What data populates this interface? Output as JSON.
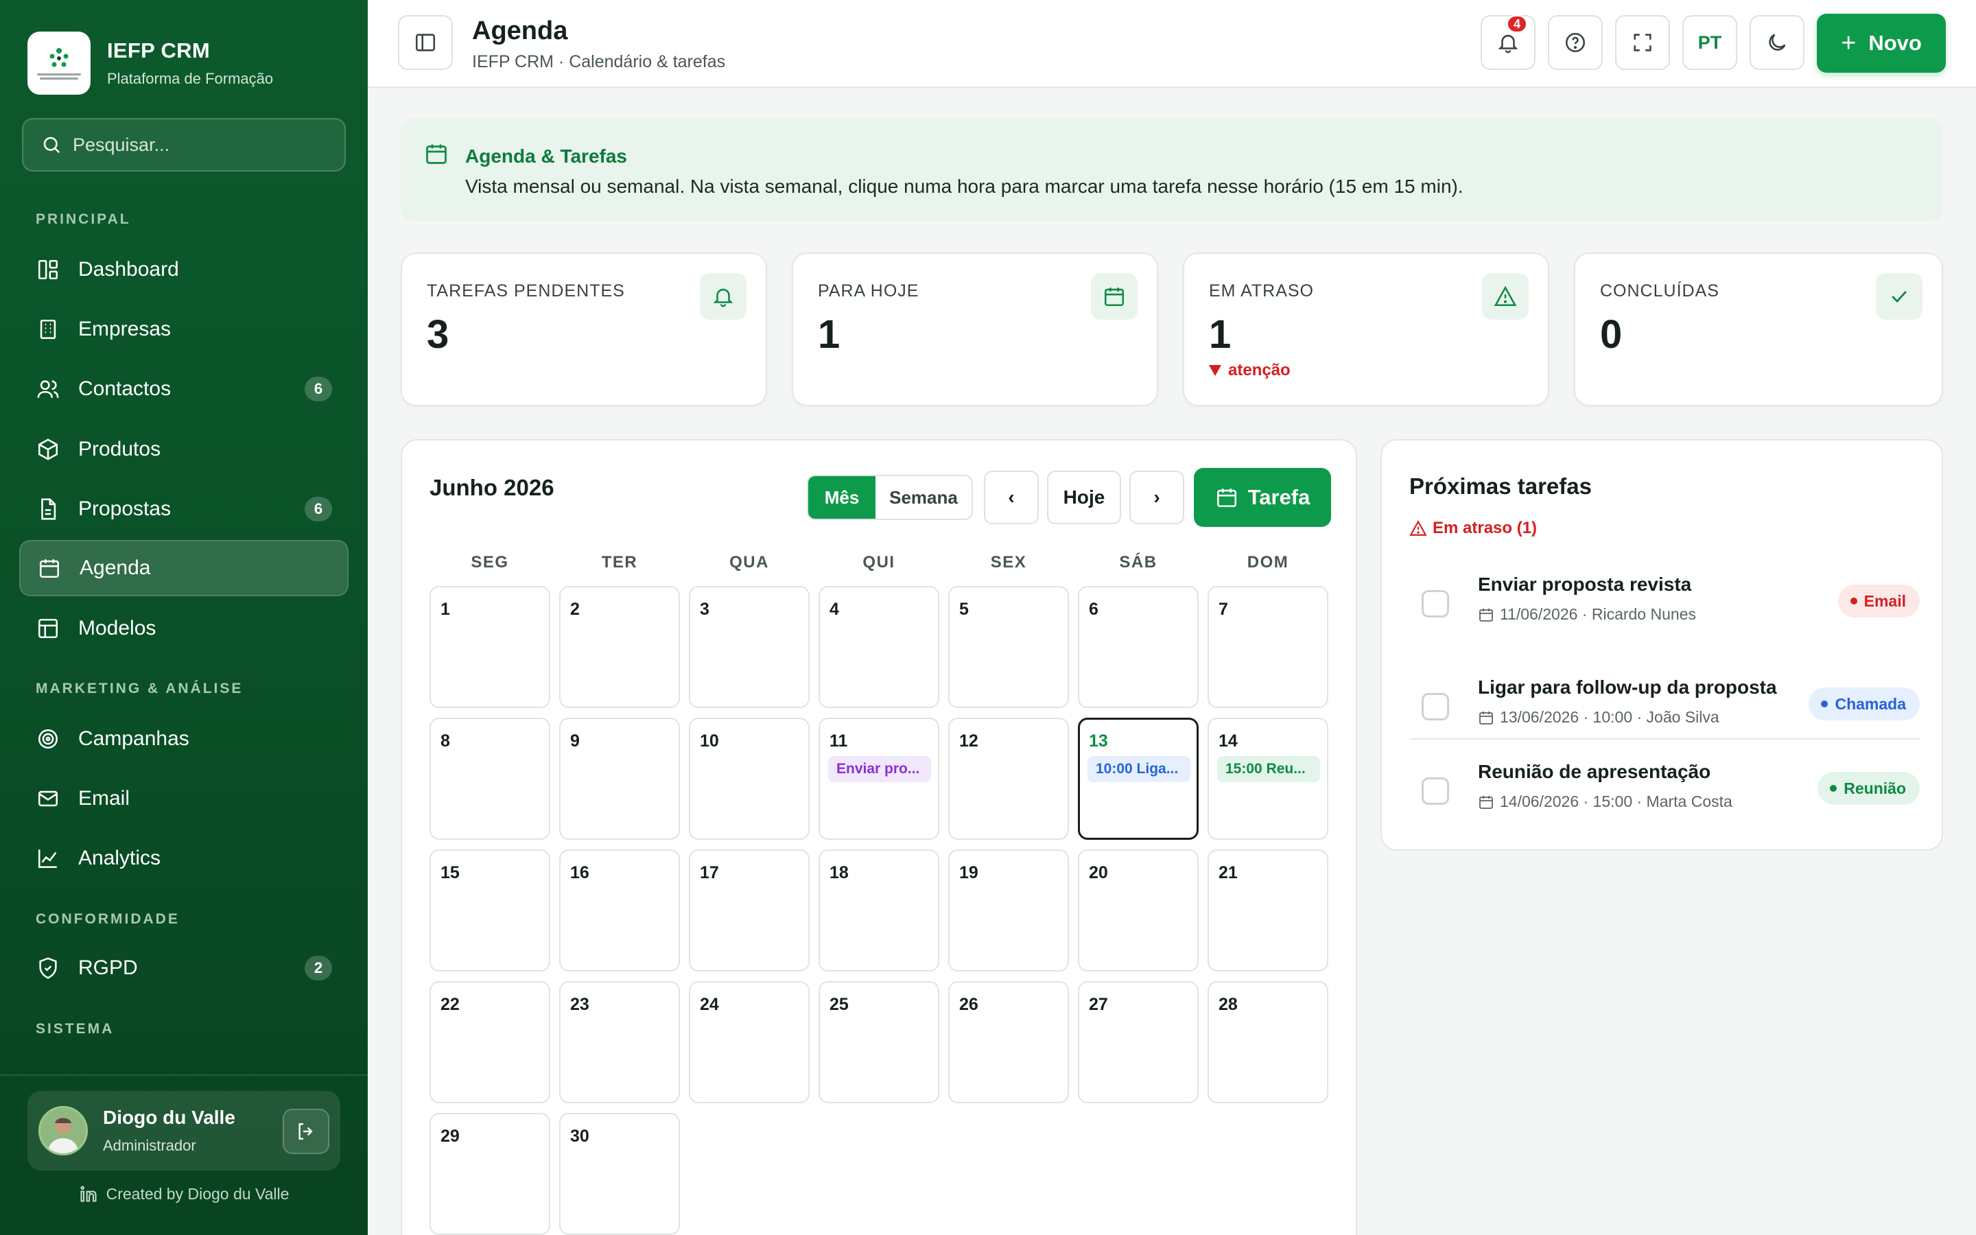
{
  "brand": {
    "title": "IEFP CRM",
    "subtitle": "Plataforma de Formação"
  },
  "search": {
    "placeholder": "Pesquisar..."
  },
  "sidebar": {
    "sections": [
      {
        "title": "PRINCIPAL"
      },
      {
        "title": "MARKETING & ANÁLISE"
      },
      {
        "title": "CONFORMIDADE"
      },
      {
        "title": "SISTEMA"
      }
    ],
    "items": [
      {
        "label": "Dashboard",
        "icon": "dashboard-icon"
      },
      {
        "label": "Empresas",
        "icon": "building-icon"
      },
      {
        "label": "Contactos",
        "icon": "users-icon",
        "badge": "6"
      },
      {
        "label": "Produtos",
        "icon": "box-icon"
      },
      {
        "label": "Propostas",
        "icon": "file-icon",
        "badge": "6"
      },
      {
        "label": "Agenda",
        "icon": "calendar-icon",
        "active": true
      },
      {
        "label": "Modelos",
        "icon": "layout-icon"
      },
      {
        "label": "Campanhas",
        "icon": "target-icon"
      },
      {
        "label": "Email",
        "icon": "mail-icon"
      },
      {
        "label": "Analytics",
        "icon": "chart-line-icon"
      },
      {
        "label": "RGPD",
        "icon": "shield-icon",
        "badge": "2"
      }
    ]
  },
  "user": {
    "name": "Diogo du Valle",
    "role": "Administrador"
  },
  "credit": "Created by Diogo du Valle",
  "header": {
    "title": "Agenda",
    "subtitle": "IEFP CRM · Calendário & tarefas",
    "notification_count": "4",
    "language": "PT",
    "new_label": "Novo"
  },
  "banner": {
    "title": "Agenda & Tarefas",
    "text": "Vista mensal ou semanal. Na vista semanal, clique numa hora para marcar uma tarefa nesse horário (15 em 15 min)."
  },
  "stats": [
    {
      "label": "TAREFAS PENDENTES",
      "value": "3",
      "icon": "bell-icon"
    },
    {
      "label": "PARA HOJE",
      "value": "1",
      "icon": "calendar-icon"
    },
    {
      "label": "EM ATRASO",
      "value": "1",
      "icon": "alert-triangle-icon",
      "note": "atenção"
    },
    {
      "label": "CONCLUÍDAS",
      "value": "0",
      "icon": "check-icon"
    }
  ],
  "calendar": {
    "title": "Junho 2026",
    "view_month": "Mês",
    "view_week": "Semana",
    "prev": "‹",
    "today": "Hoje",
    "next": "›",
    "add_task": "Tarefa",
    "weekdays": [
      "SEG",
      "TER",
      "QUA",
      "QUI",
      "SEX",
      "SÁB",
      "DOM"
    ],
    "days": [
      "1",
      "2",
      "3",
      "4",
      "5",
      "6",
      "7",
      "8",
      "9",
      "10",
      "11",
      "12",
      "13",
      "14",
      "15",
      "16",
      "17",
      "18",
      "19",
      "20",
      "21",
      "22",
      "23",
      "24",
      "25",
      "26",
      "27",
      "28",
      "29",
      "30"
    ],
    "today_day": "13",
    "events": [
      {
        "day": "11",
        "label": "Enviar pro...",
        "color": "purple"
      },
      {
        "day": "13",
        "label": "10:00 Liga...",
        "color": "blue"
      },
      {
        "day": "14",
        "label": "15:00 Reu...",
        "color": "green"
      }
    ]
  },
  "upcoming": {
    "title": "Próximas tarefas",
    "overdue_label": "Em atraso (1)",
    "tasks": [
      {
        "title": "Enviar proposta revista",
        "meta": "11/06/2026 · Ricardo Nunes",
        "tag": "Email",
        "tag_color": "red"
      },
      {
        "title": "Ligar para follow-up da proposta",
        "meta": "13/06/2026 · 10:00 · João Silva",
        "tag": "Chamada",
        "tag_color": "blue"
      },
      {
        "title": "Reunião de apresentação",
        "meta": "14/06/2026 · 15:00 · Marta Costa",
        "tag": "Reunião",
        "tag_color": "green"
      }
    ]
  },
  "colors": {
    "sidebar": "#0a4f27",
    "accent": "#0e9a4b",
    "danger": "#d32020",
    "info": "#2563d9",
    "event_purple": "#8a2fd6"
  }
}
